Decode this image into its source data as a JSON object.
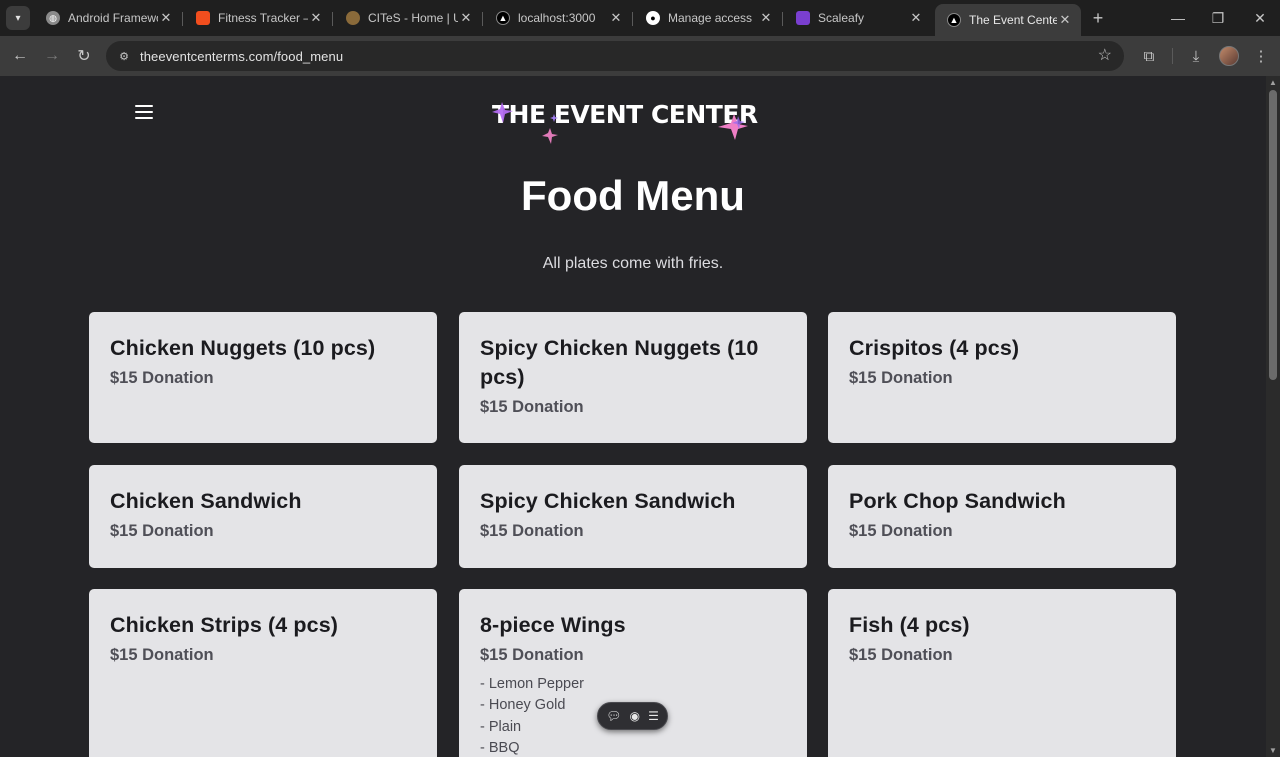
{
  "browser": {
    "tabs": [
      {
        "title": "Android Framewor",
        "favicon": "globe-icon",
        "color": "#8a8a8a"
      },
      {
        "title": "Fitness Tracker – F",
        "favicon": "figma-icon",
        "color": "#f24e1e"
      },
      {
        "title": "CITeS - Home | Un",
        "favicon": "crest-icon",
        "color": "#8a6a3a"
      },
      {
        "title": "localhost:3000",
        "favicon": "triangle-icon",
        "color": "#000000"
      },
      {
        "title": "Manage access",
        "favicon": "github-icon",
        "color": "#000000"
      },
      {
        "title": "Scaleafy",
        "favicon": "scaleafy-icon",
        "color": "#7a3fd0"
      },
      {
        "title": "The Event Center",
        "favicon": "triangle-icon",
        "color": "#000000"
      }
    ],
    "url": "theeventcenterms.com/food_menu"
  },
  "page": {
    "logo_text": "THE EVENT CENTER",
    "title": "Food Menu",
    "subtitle": "All plates come with fries."
  },
  "menu_items": [
    {
      "name": "Chicken Nuggets (10 pcs)",
      "price": "$15 Donation"
    },
    {
      "name": "Spicy Chicken Nuggets (10 pcs)",
      "price": "$15 Donation"
    },
    {
      "name": "Crispitos (4 pcs)",
      "price": "$15 Donation"
    },
    {
      "name": "Chicken Sandwich",
      "price": "$15 Donation"
    },
    {
      "name": "Spicy Chicken Sandwich",
      "price": "$15 Donation"
    },
    {
      "name": "Pork Chop Sandwich",
      "price": "$15 Donation"
    },
    {
      "name": "Chicken Strips (4 pcs)",
      "price": "$15 Donation"
    },
    {
      "name": "8-piece Wings",
      "price": "$15 Donation",
      "flavors": [
        "- Lemon Pepper",
        "- Honey Gold",
        "- Plain",
        "- BBQ"
      ]
    },
    {
      "name": "Fish (4 pcs)",
      "price": "$15 Donation"
    }
  ],
  "colors": {
    "page_bg": "#242427",
    "card_bg": "#e4e4e7",
    "sparkle_pink": "#f07bc0",
    "sparkle_purple": "#9b6cf0"
  }
}
